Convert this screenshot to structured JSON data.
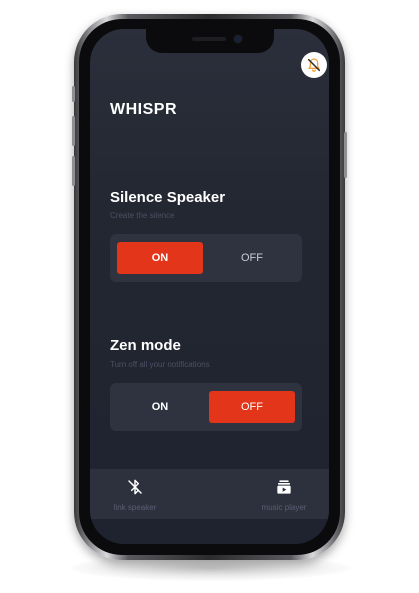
{
  "app": {
    "title": "WHISPR"
  },
  "header": {
    "bell_icon": "bell-off-icon"
  },
  "silence_speaker": {
    "title": "Silence Speaker",
    "subtitle": "Create the silence",
    "on_label": "ON",
    "off_label": "OFF",
    "selected": "ON"
  },
  "zen_mode": {
    "title": "Zen mode",
    "subtitle": "Turn off all your notifications",
    "on_label": "ON",
    "off_label": "OFF",
    "selected": "OFF"
  },
  "tabbar": {
    "items": [
      {
        "label": "link speaker",
        "icon": "bluetooth-off-icon"
      },
      {
        "label": "music player",
        "icon": "playlist-play-icon"
      }
    ]
  },
  "colors": {
    "accent": "#e2351a",
    "background": "#232731",
    "card": "#2f3340",
    "tabbar": "#2d313d",
    "subtitle": "#4b5063"
  }
}
